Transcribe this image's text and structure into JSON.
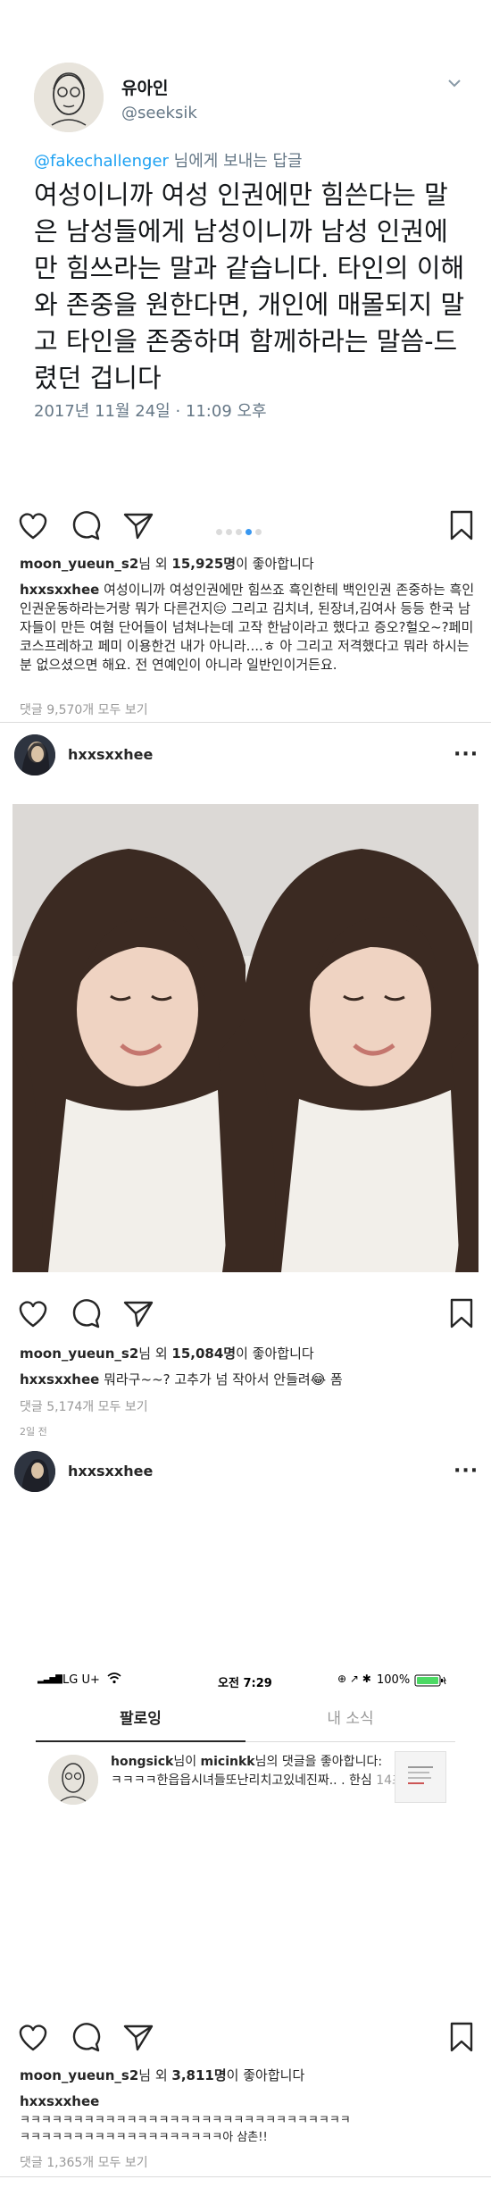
{
  "tweet": {
    "name": "유아인",
    "handle": "@seeksik",
    "reply_mention": "@fakechallenger",
    "reply_suffix": " 님에게 보내는 답글",
    "body": "여성이니까 여성 인권에만 힘쓴다는 말은 남성들에게 남성이니까 남성 인권에만 힘쓰라는 말과 같습니다. 타인의 이해와 존중을 원한다면, 개인에 매몰되지 말고 타인을 존중하며 함께하라는 말씀-드렸던 겁니다",
    "timestamp": "2017년 11월 24일 · 11:09 오후"
  },
  "post1": {
    "carousel_dots": 5,
    "carousel_active": 3,
    "likes_user": "moon_yueun_s2",
    "likes_mid": "님 외 ",
    "likes_count": "15,925명",
    "likes_suffix": "이 좋아합니다",
    "caption_user": "hxxsxxhee",
    "caption_text": " 여성이니까 여성인권에만 힘쓰죠 흑인한테 백인인권 존중하는 흑인인권운동하라는거랑 뭐가 다른건지😑 그리고 김치녀, 된장녀,김여사 등등 한국 남자들이 만든 여혐 단어들이 넘쳐나는데 고작 한남이라고 했다고 증오?헐오~?페미 코스프레하고 페미 이용한건 내가 아니라....ㅎ 아 그리고 저격했다고 뭐라 하시는 분 없으셨으면 해요. 전 연예인이 아니라 일반인이거든요.",
    "comments_link": "댓글 9,570개 모두 보기"
  },
  "post2": {
    "username": "hxxsxxhee",
    "likes_user": "moon_yueun_s2",
    "likes_mid": "님 외 ",
    "likes_count": "15,084명",
    "likes_suffix": "이 좋아합니다",
    "caption_user": "hxxsxxhee",
    "caption_text": " 뭐라구~~? 고추가 넘 작아서 안들려😂 폼",
    "comments_link": "댓글 5,174개 모두 보기",
    "time_ago": "2일 전"
  },
  "post3": {
    "username": "hxxsxxhee",
    "screenshot": {
      "carrier": "LG U+",
      "time": "오전 7:29",
      "battery": "100%",
      "tab_following": "팔로잉",
      "tab_you": "내 소식",
      "notif_user1": "hongsick",
      "notif_mid": "님이 ",
      "notif_user2": "micinkk",
      "notif_action": "님의 댓글을 좋아합니다:",
      "notif_comment": "ㅋㅋㅋㅋ한읍읍시녀들또난리치고있네진짜.. . 한심",
      "notif_time": "14초"
    },
    "likes_user": "moon_yueun_s2",
    "likes_mid": "님 외 ",
    "likes_count": "3,811명",
    "likes_suffix": "이 좋아합니다",
    "caption_user": "hxxsxxhee",
    "caption_line1": "ㅋㅋㅋㅋㅋㅋㅋㅋㅋㅋㅋㅋㅋㅋㅋㅋㅋㅋㅋㅋㅋㅋㅋㅋㅋㅋㅋㅋㅋㅋㅋ",
    "caption_line2": "ㅋㅋㅋㅋㅋㅋㅋㅋㅋㅋㅋㅋㅋㅋㅋㅋㅋㅋㅋ아 삼촌!!",
    "comments_link": "댓글 1,365개 모두 보기"
  },
  "colors": {
    "link_blue": "#1da1f2",
    "dot_active": "#3897f0",
    "text": "#262626",
    "muted": "#999999"
  },
  "icons": [
    "heart-icon",
    "comment-icon",
    "share-icon",
    "bookmark-icon",
    "chevron-down-icon",
    "more-icon",
    "wifi-icon",
    "battery-icon"
  ]
}
